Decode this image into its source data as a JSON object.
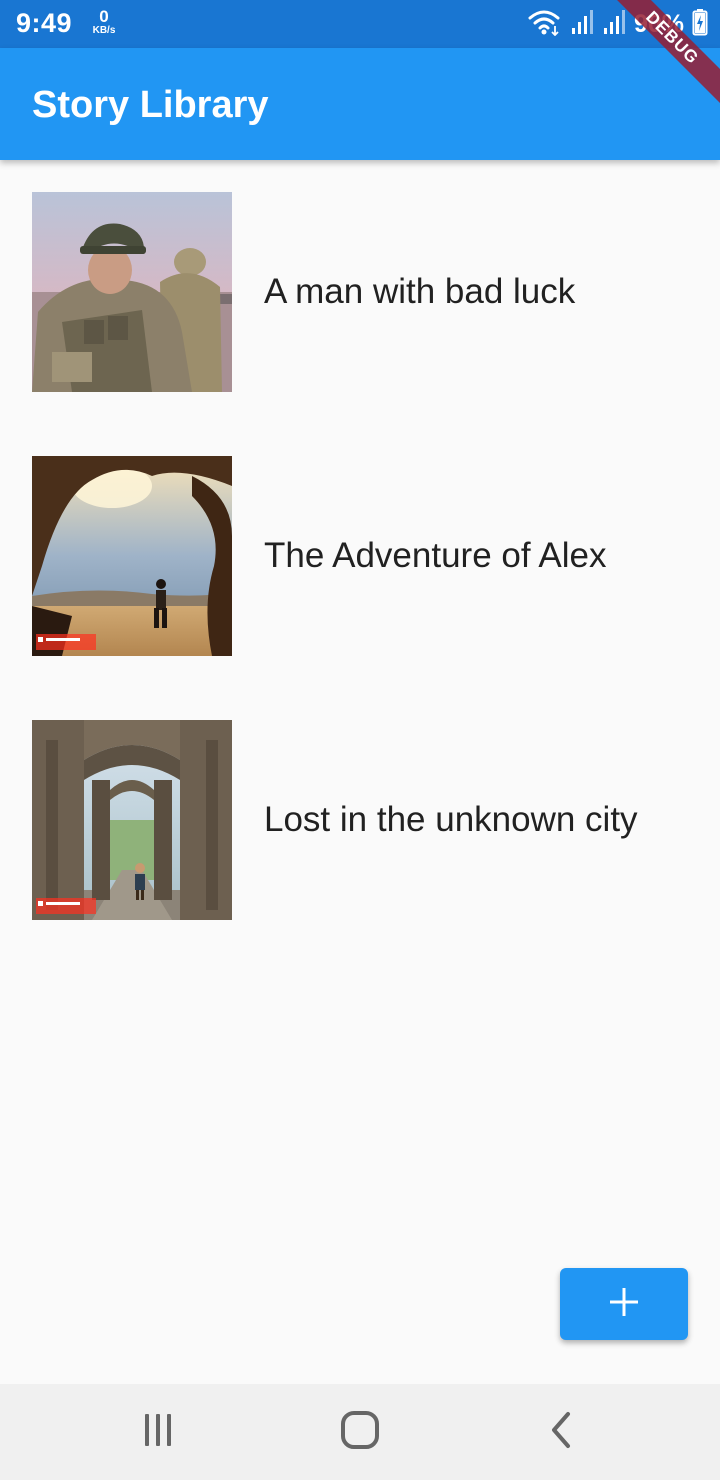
{
  "status_bar": {
    "time": "9:49",
    "net_speed_value": "0",
    "net_speed_unit": "KB/s",
    "battery": "90%",
    "icons": [
      "wifi-icon",
      "signal-icon",
      "signal-icon",
      "battery-charging-icon"
    ]
  },
  "debug_banner": "DEBUG",
  "app_bar": {
    "title": "Story Library"
  },
  "stories": [
    {
      "title": "A man with bad luck",
      "thumbnail": "soldier-photo"
    },
    {
      "title": "The Adventure of Alex",
      "thumbnail": "cave-desert-illustration"
    },
    {
      "title": "Lost in the unknown city",
      "thumbnail": "ancient-ruins-illustration"
    }
  ],
  "fab": {
    "icon": "plus-icon"
  },
  "nav_bar": {
    "icons": [
      "recent-apps-icon",
      "home-icon",
      "back-icon"
    ]
  },
  "colors": {
    "status_bar": "#1976d2",
    "app_bar": "#2196f3",
    "fab": "#2196f3",
    "background": "#fafafa",
    "nav_bar": "#f0f0f0"
  }
}
